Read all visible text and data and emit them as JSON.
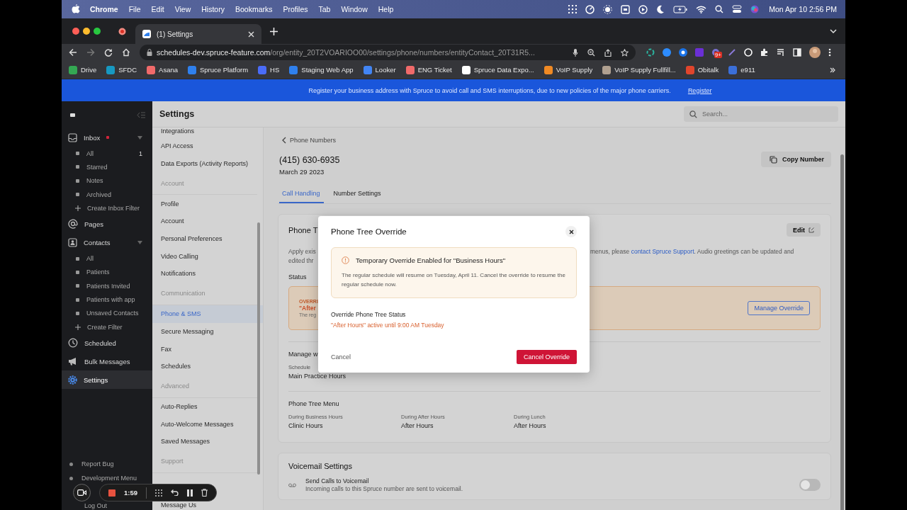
{
  "menubar": {
    "app": "Chrome",
    "items": [
      "File",
      "Edit",
      "View",
      "History",
      "Bookmarks",
      "Profiles",
      "Tab",
      "Window",
      "Help"
    ],
    "clock": "Mon Apr 10  2:56 PM"
  },
  "browser": {
    "tabs": [
      {
        "title": "(1) Settings",
        "selected": true
      }
    ],
    "url_host": "schedules-dev.spruce-feature.com",
    "url_path": "/org/entity_20T2VOARIOO00/settings/phone/numbers/entityContact_20T31R5...",
    "extension_badge": "9+",
    "bookmarks": [
      {
        "label": "Drive",
        "color": "#34a853"
      },
      {
        "label": "SFDC",
        "color": "#1798c1"
      },
      {
        "label": "Asana",
        "color": "#f06a6a"
      },
      {
        "label": "Spruce Platform",
        "color": "#2f80ed"
      },
      {
        "label": "HS",
        "color": "#4a6cf7"
      },
      {
        "label": "Staging Web App",
        "color": "#2f80ed"
      },
      {
        "label": "Looker",
        "color": "#4285f4"
      },
      {
        "label": "ENG Ticket",
        "color": "#f06a6a"
      },
      {
        "label": "Spruce Data Expo...",
        "color": "#ffffff"
      },
      {
        "label": "VoIP Supply",
        "color": "#f08a24"
      },
      {
        "label": "VoIP Supply Fullfill...",
        "color": "#b0a090"
      },
      {
        "label": "Obitalk",
        "color": "#e0452c"
      },
      {
        "label": "e911",
        "color": "#3b6fd8"
      }
    ]
  },
  "banner": {
    "text": "Register your business address with Spruce to avoid call and SMS interruptions, due to new policies of the major phone carriers.",
    "link": "Register"
  },
  "sidebar": {
    "items": [
      {
        "label": "Inbox",
        "kind": "inbox",
        "unread": true,
        "selected": false,
        "expanded": true,
        "children": [
          {
            "label": "All",
            "kind": "bullet",
            "count": "1"
          },
          {
            "label": "Starred",
            "kind": "bullet"
          },
          {
            "label": "Notes",
            "kind": "bullet"
          },
          {
            "label": "Archived",
            "kind": "bullet"
          },
          {
            "label": "Create Inbox Filter",
            "kind": "add"
          }
        ]
      },
      {
        "label": "Pages",
        "kind": "at",
        "unread": false,
        "selected": false
      },
      {
        "label": "Contacts",
        "kind": "contacts",
        "unread": false,
        "selected": false,
        "expanded": true,
        "children": [
          {
            "label": "All",
            "kind": "bullet"
          },
          {
            "label": "Patients",
            "kind": "bullet"
          },
          {
            "label": "Patients Invited",
            "kind": "bullet"
          },
          {
            "label": "Patients with app",
            "kind": "bullet"
          },
          {
            "label": "Unsaved Contacts",
            "kind": "bullet"
          },
          {
            "label": "Create Filter",
            "kind": "add"
          }
        ]
      },
      {
        "label": "Scheduled",
        "kind": "clock",
        "unread": false,
        "selected": false
      },
      {
        "label": "Bulk Messages",
        "kind": "megaphone",
        "unread": false,
        "selected": false
      },
      {
        "label": "Settings",
        "kind": "gear",
        "unread": false,
        "selected": true
      }
    ],
    "footer": [
      "Report Bug",
      "Development Menu",
      "Log Out"
    ]
  },
  "settings_nav": {
    "title": "Settings",
    "items": [
      {
        "label": "Integrations",
        "kind": "item",
        "selected": false
      },
      {
        "label": "API Access",
        "kind": "item",
        "selected": false
      },
      {
        "label": "Data Exports (Activity Reports)",
        "kind": "item",
        "selected": false
      },
      {
        "label": "Account",
        "kind": "heading"
      },
      {
        "label": "Profile",
        "kind": "item",
        "selected": false
      },
      {
        "label": "Account",
        "kind": "item",
        "selected": false
      },
      {
        "label": "Personal Preferences",
        "kind": "item",
        "selected": false
      },
      {
        "label": "Video Calling",
        "kind": "item",
        "selected": false
      },
      {
        "label": "Notifications",
        "kind": "item",
        "selected": false
      },
      {
        "label": "Communication",
        "kind": "heading"
      },
      {
        "label": "Phone & SMS",
        "kind": "item",
        "selected": true
      },
      {
        "label": "Secure Messaging",
        "kind": "item",
        "selected": false
      },
      {
        "label": "Fax",
        "kind": "item",
        "selected": false
      },
      {
        "label": "Schedules",
        "kind": "item",
        "selected": false
      },
      {
        "label": "Advanced",
        "kind": "heading"
      },
      {
        "label": "Auto-Replies",
        "kind": "item",
        "selected": false
      },
      {
        "label": "Auto-Welcome Messages",
        "kind": "item",
        "selected": false
      },
      {
        "label": "Saved Messages",
        "kind": "item",
        "selected": false
      },
      {
        "label": "Support",
        "kind": "heading"
      },
      {
        "label": "Message Us",
        "kind": "item",
        "selected": false
      }
    ]
  },
  "search": {
    "placeholder": "Search..."
  },
  "page": {
    "back": "Phone Numbers",
    "number": "(415) 630-6935",
    "date": "March 29 2023",
    "copy_button": "Copy Number",
    "tabs": [
      {
        "label": "Call Handling",
        "selected": true
      },
      {
        "label": "Number Settings",
        "selected": false
      }
    ]
  },
  "phone_tree_card": {
    "title": "Phone T",
    "edit_button": "Edit",
    "desc_left": [
      "Apply exis",
      "edited thr"
    ],
    "desc_right": "menus, please ",
    "desc_link": "contact Spruce Support",
    "desc_tail": ". Audio greetings can be updated and",
    "status_label": "Status",
    "override": {
      "tag": "OVERRI",
      "value": "\"After",
      "note": "The reg",
      "button": "Manage Override"
    },
    "manage_label": "Manage w",
    "schedule_label": "Schedule",
    "schedule_value": "Main Practice Hours",
    "menu_title": "Phone Tree Menu",
    "menu": [
      {
        "label": "During Business Hours",
        "value": "Clinic Hours"
      },
      {
        "label": "During After Hours",
        "value": "After Hours"
      },
      {
        "label": "During Lunch",
        "value": "After Hours"
      }
    ]
  },
  "voicemail_card": {
    "title": "Voicemail Settings",
    "item_title": "Send Calls to Voicemail",
    "item_desc": "Incoming calls to this Spruce number are sent to voicemail.",
    "on": false
  },
  "modal": {
    "title": "Phone Tree Override",
    "alert_title": "Temporary Override Enabled for \"Business Hours\"",
    "alert_text": "The regular schedule will resume on Tuesday, April 11. Cancel the override to resume the regular schedule now.",
    "status_label": "Override Phone Tree Status",
    "status_value": "\"After Hours\" active until 9:00 AM Tuesday",
    "cancel": "Cancel",
    "confirm": "Cancel Override"
  },
  "recorder": {
    "time": "1:59"
  }
}
